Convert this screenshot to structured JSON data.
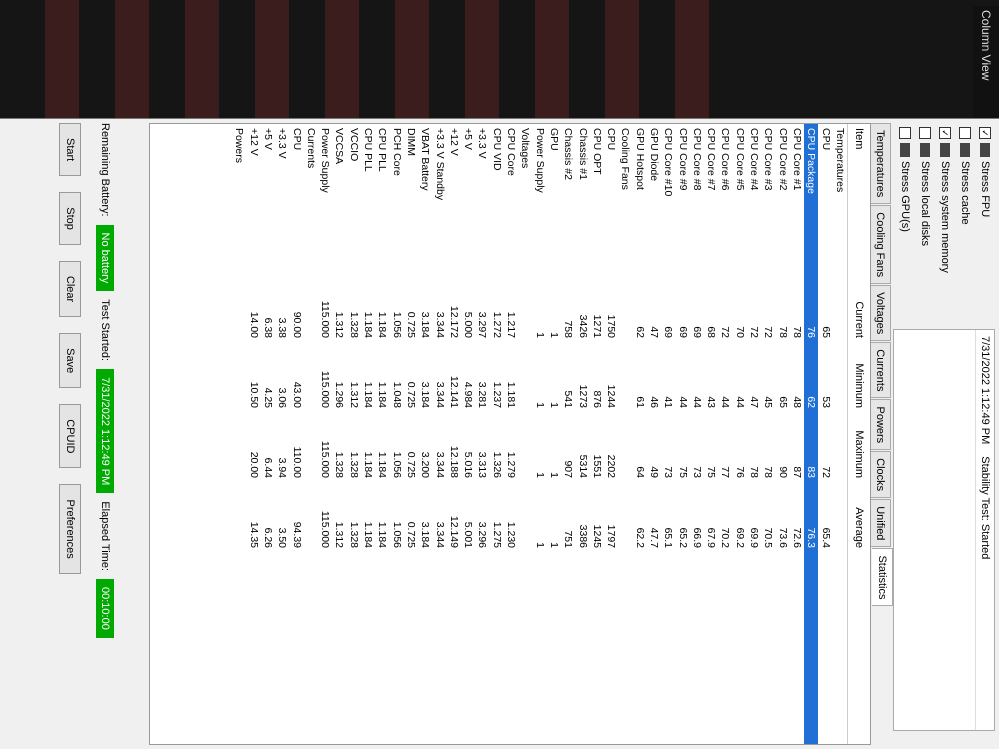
{
  "sidebar": {
    "column_view": "Column View"
  },
  "stress": {
    "items": [
      "Stress FPU",
      "Stress cache",
      "Stress system memory",
      "Stress local disks",
      "Stress GPU(s)"
    ],
    "checked": [
      true,
      false,
      true,
      false,
      false
    ]
  },
  "status": {
    "header_date": "7/31/2022 1:12:49 PM",
    "header_status": "Stability Test: Started"
  },
  "tabs": [
    "Temperatures",
    "Cooling Fans",
    "Voltages",
    "Currents",
    "Powers",
    "Clocks",
    "Unified",
    "Statistics"
  ],
  "table": {
    "headers": [
      "Item",
      "Current",
      "Minimum",
      "Maximum",
      "Average"
    ],
    "rows": [
      [
        "Temperatures",
        "",
        "",
        "",
        ""
      ],
      [
        "CPU",
        "65",
        "53",
        "72",
        "65.4"
      ],
      [
        "CPU Package",
        "76",
        "62",
        "83",
        "76.3"
      ],
      [
        "CPU Core #1",
        "78",
        "48",
        "87",
        "72.6"
      ],
      [
        "CPU Core #2",
        "78",
        "65",
        "90",
        "73.6"
      ],
      [
        "CPU Core #3",
        "72",
        "45",
        "78",
        "70.5"
      ],
      [
        "CPU Core #4",
        "72",
        "47",
        "78",
        "69.9"
      ],
      [
        "CPU Core #5",
        "70",
        "44",
        "76",
        "69.2"
      ],
      [
        "CPU Core #6",
        "72",
        "44",
        "77",
        "70.2"
      ],
      [
        "CPU Core #7",
        "68",
        "43",
        "75",
        "67.9"
      ],
      [
        "CPU Core #8",
        "69",
        "44",
        "73",
        "66.9"
      ],
      [
        "CPU Core #9",
        "69",
        "44",
        "75",
        "65.2"
      ],
      [
        "CPU Core #10",
        "69",
        "41",
        "73",
        "65.1"
      ],
      [
        "GPU Diode",
        "47",
        "46",
        "49",
        "47.7"
      ],
      [
        "GPU Hotspot",
        "62",
        "61",
        "64",
        "62.2"
      ],
      [
        "Cooling Fans",
        "",
        "",
        "",
        ""
      ],
      [
        "CPU",
        "1750",
        "1244",
        "2202",
        "1797"
      ],
      [
        "CPU OPT",
        "1271",
        "876",
        "1551",
        "1245"
      ],
      [
        "Chassis #1",
        "3426",
        "1273",
        "5314",
        "3386"
      ],
      [
        "Chassis #2",
        "758",
        "541",
        "907",
        "751"
      ],
      [
        "GPU",
        "1",
        "1",
        "1",
        "1"
      ],
      [
        "Power Supply",
        "1",
        "1",
        "1",
        "1"
      ],
      [
        "Voltages",
        "",
        "",
        "",
        ""
      ],
      [
        "CPU Core",
        "1.217",
        "1.181",
        "1.279",
        "1.230"
      ],
      [
        "CPU VID",
        "1.272",
        "1.237",
        "1.326",
        "1.275"
      ],
      [
        "+3.3 V",
        "3.297",
        "3.281",
        "3.313",
        "3.296"
      ],
      [
        "+5 V",
        "5.000",
        "4.984",
        "5.016",
        "5.001"
      ],
      [
        "+12 V",
        "12.172",
        "12.141",
        "12.188",
        "12.149"
      ],
      [
        "+3.3 V Standby",
        "3.344",
        "3.344",
        "3.344",
        "3.344"
      ],
      [
        "VBAT Battery",
        "3.184",
        "3.184",
        "3.200",
        "3.184"
      ],
      [
        "DIMM",
        "0.725",
        "0.725",
        "0.725",
        "0.725"
      ],
      [
        "PCH Core",
        "1.056",
        "1.048",
        "1.056",
        "1.056"
      ],
      [
        "CPU PLL",
        "1.184",
        "1.184",
        "1.184",
        "1.184"
      ],
      [
        "CPU PLL",
        "1.184",
        "1.184",
        "1.184",
        "1.184"
      ],
      [
        "VCCIO",
        "1.328",
        "1.312",
        "1.328",
        "1.328"
      ],
      [
        "VCCSA",
        "1.312",
        "1.296",
        "1.328",
        "1.312"
      ],
      [
        "Power Supply",
        "115.000",
        "115.000",
        "115.000",
        "115.000"
      ],
      [
        "Currents",
        "",
        "",
        "",
        ""
      ],
      [
        "CPU",
        "90.00",
        "43.00",
        "110.00",
        "94.39"
      ],
      [
        "+3.3 V",
        "3.38",
        "3.06",
        "3.94",
        "3.50"
      ],
      [
        "+5 V",
        "6.38",
        "4.25",
        "6.44",
        "6.26"
      ],
      [
        "+12 V",
        "14.00",
        "10.50",
        "20.00",
        "14.35"
      ],
      [
        "Powers",
        "",
        "",
        "",
        ""
      ]
    ],
    "selected_index": 2
  },
  "bottom": {
    "remaining_battery_label": "Remaining Battery:",
    "remaining_battery_value": "No battery",
    "test_started_label": "Test Started:",
    "test_started_value": "7/31/2022 1:12:49 PM",
    "elapsed_label": "Elapsed Time:",
    "elapsed_value": "00:10:00",
    "buttons": [
      "Start",
      "Stop",
      "Clear",
      "Save",
      "CPUID",
      "Preferences"
    ]
  }
}
